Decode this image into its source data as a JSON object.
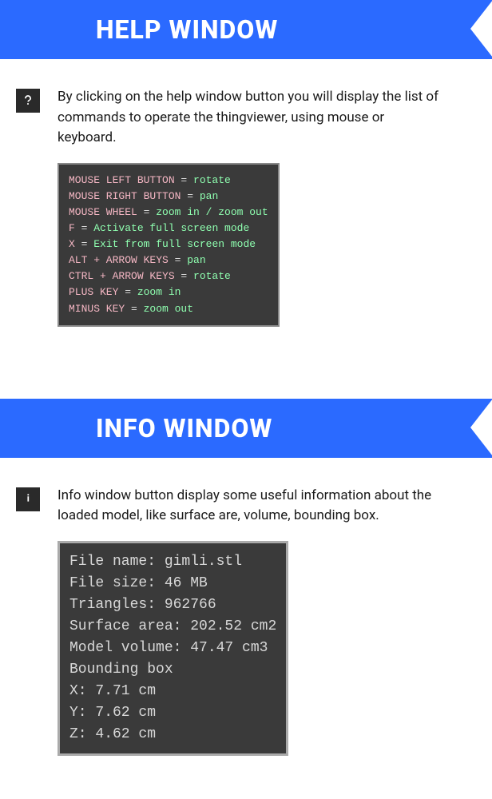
{
  "help": {
    "title": "HELP WINDOW",
    "description": "By clicking on the help window button you will display the list of commands to operate the thingviewer, using mouse or keyboard.",
    "commands": [
      {
        "key": "MOUSE LEFT BUTTON",
        "value": "rotate"
      },
      {
        "key": "MOUSE RIGHT BUTTON",
        "value": "pan"
      },
      {
        "key": "MOUSE WHEEL",
        "value": "zoom in / zoom out"
      },
      {
        "key": "F",
        "value": "Activate full screen mode"
      },
      {
        "key": "X",
        "value": "Exit from full screen mode"
      },
      {
        "key": "ALT + ARROW KEYS",
        "value": "pan"
      },
      {
        "key": "CTRL + ARROW KEYS",
        "value": "rotate"
      },
      {
        "key": "PLUS KEY",
        "value": "zoom in"
      },
      {
        "key": "MINUS KEY",
        "value": "zoom out"
      }
    ]
  },
  "info": {
    "title": "INFO WINDOW",
    "description": "Info window button display some useful information about the loaded model, like surface are, volume, bounding box.",
    "lines": [
      "File name: gimli.stl",
      "File size: 46 MB",
      "Triangles: 962766",
      "Surface area: 202.52 cm2",
      "Model volume: 47.47 cm3",
      "Bounding box",
      "X: 7.71 cm",
      "Y: 7.62 cm",
      "Z: 4.62 cm"
    ]
  }
}
